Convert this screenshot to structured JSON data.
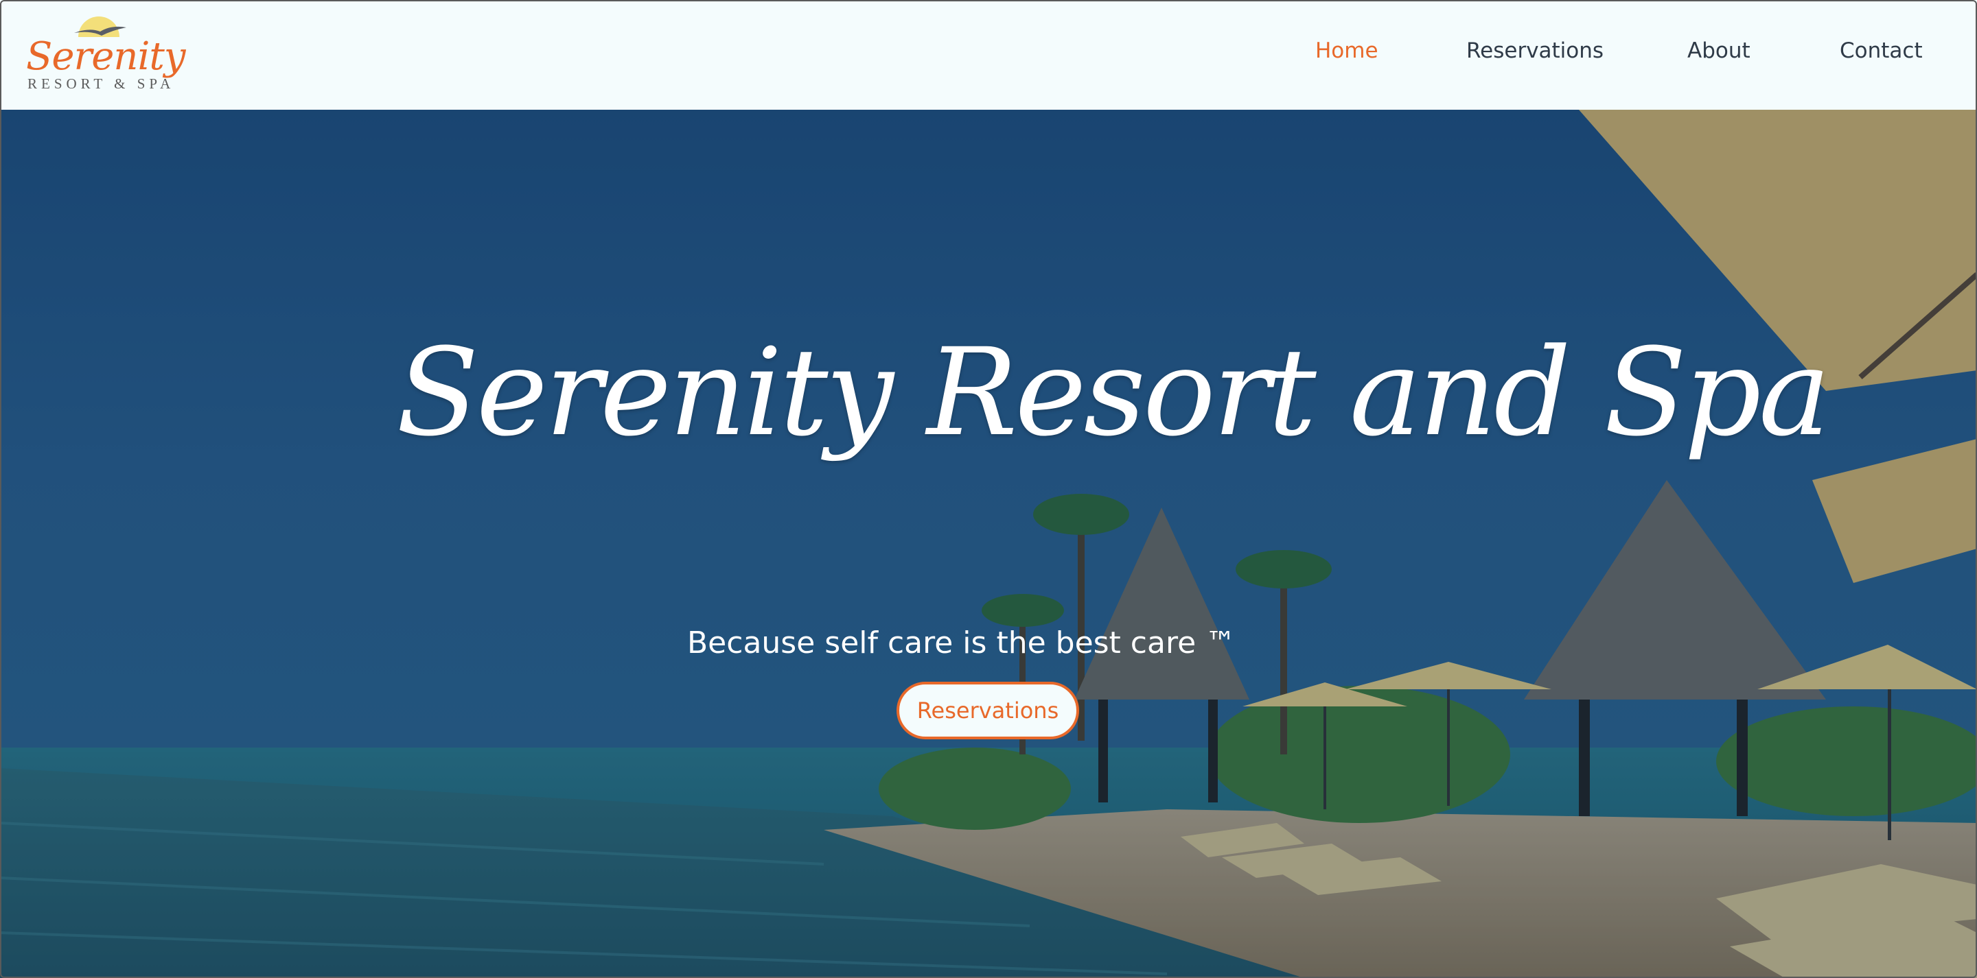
{
  "brand": {
    "name": "Serenity",
    "subtitle": "RESORT & SPA",
    "logo_icon": "sun-with-bird-icon"
  },
  "nav": {
    "items": [
      {
        "label": "Home",
        "active": true
      },
      {
        "label": "Reservations",
        "active": false
      },
      {
        "label": "About",
        "active": false
      },
      {
        "label": "Contact",
        "active": false
      }
    ]
  },
  "hero": {
    "title": "Serenity Resort and Spa",
    "tagline": "Because self care is the best care ™",
    "cta_label": "Reservations",
    "background": "tropical resort pool with thatched cabanas, palm trees and sun loungers"
  },
  "colors": {
    "accent": "#e8692a",
    "header_bg": "#f4fcfd",
    "nav_text": "#2f3b48",
    "logo_sun": "#f3df7a"
  }
}
